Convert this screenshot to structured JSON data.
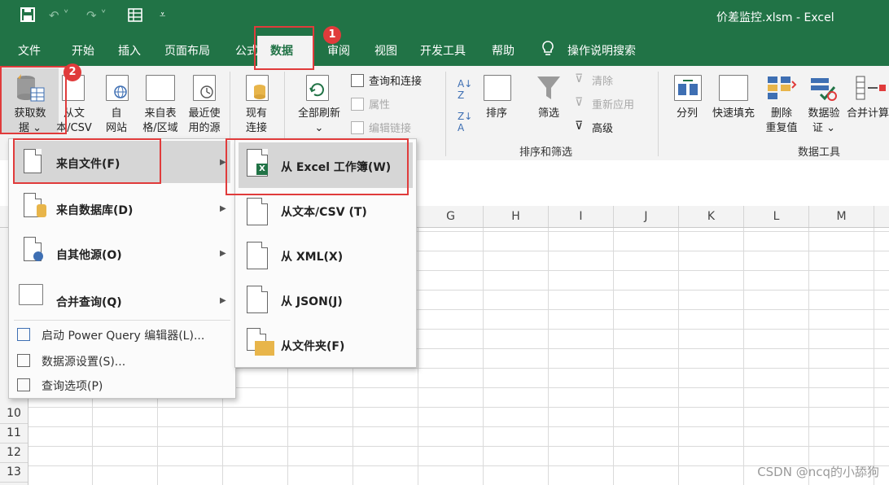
{
  "window": {
    "title": "价差监控.xlsm  -  Excel"
  },
  "qat": {
    "save_icon": "save-icon",
    "undo_icon": "undo-icon",
    "redo_icon": "redo-icon",
    "form_icon": "form-icon",
    "customize_icon": "customize-qat-icon"
  },
  "tabs": [
    {
      "label": "文件"
    },
    {
      "label": "开始"
    },
    {
      "label": "插入"
    },
    {
      "label": "页面布局"
    },
    {
      "label": "公式"
    },
    {
      "label": "数据"
    },
    {
      "label": "审阅"
    },
    {
      "label": "视图"
    },
    {
      "label": "开发工具"
    },
    {
      "label": "帮助"
    }
  ],
  "tell_me": {
    "icon": "lightbulb-icon",
    "label": "操作说明搜索"
  },
  "ribbon": {
    "get_data": {
      "line1": "获取数",
      "line2": "据 ⌄"
    },
    "from_text": {
      "line1": "从文",
      "line2": "本/CSV"
    },
    "from_web": {
      "line1": "自",
      "line2": "网站"
    },
    "from_table": {
      "line1": "来自表",
      "line2": "格/区域"
    },
    "recent": {
      "line1": "最近使",
      "line2": "用的源"
    },
    "existing": {
      "line1": "现有",
      "line2": "连接"
    },
    "refresh_all": {
      "line1": "全部刷新",
      "line2": "⌄"
    },
    "queries": "查询和连接",
    "properties": "属性",
    "edit_links": "编辑链接",
    "sort": "排序",
    "filter": "筛选",
    "clear": "清除",
    "reapply": "重新应用",
    "advanced": "高级",
    "group_sort_filter": "排序和筛选",
    "split": "分列",
    "flash_fill": "快速填充",
    "remove_dup": {
      "line1": "删除",
      "line2": "重复值"
    },
    "validation": {
      "line1": "数据验",
      "line2": "证 ⌄"
    },
    "consolidate": "合并计算",
    "group_data_tools": "数据工具"
  },
  "columns": [
    "G",
    "H",
    "I",
    "J",
    "K",
    "L",
    "M"
  ],
  "rows": [
    "10",
    "11",
    "12",
    "13"
  ],
  "menu_main": [
    {
      "label": "来自文件(F)"
    },
    {
      "label": "来自数据库(D)"
    },
    {
      "label": "自其他源(O)"
    },
    {
      "label": "合并查询(Q)"
    },
    {
      "label": "启动 Power Query 编辑器(L)..."
    },
    {
      "label": "数据源设置(S)..."
    },
    {
      "label": "查询选项(P)"
    }
  ],
  "menu_sub": [
    {
      "label": "从 Excel 工作簿(W)"
    },
    {
      "label": "从文本/CSV (T)"
    },
    {
      "label": "从 XML(X)"
    },
    {
      "label": "从 JSON(J)"
    },
    {
      "label": "从文件夹(F)"
    }
  ],
  "badges": [
    "1",
    "2"
  ],
  "watermark": "CSDN @ncq的小舔狗",
  "colors": {
    "excel_green": "#217346",
    "highlight_red": "#e03b3b",
    "ribbon_bg": "#f3f3f3"
  }
}
